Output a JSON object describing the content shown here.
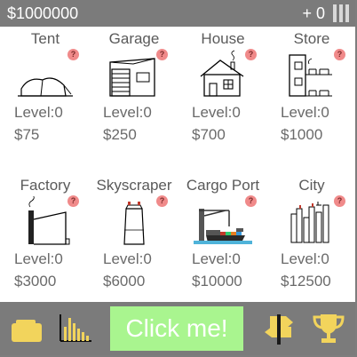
{
  "header": {
    "money": "$1000000",
    "income": "+ 0",
    "menu_icon": "hamburger-icon"
  },
  "buildings": [
    {
      "name": "Tent",
      "level_label": "Level:",
      "level": "0",
      "price": "$75",
      "icon": "tent-icon"
    },
    {
      "name": "Garage",
      "level_label": "Level:",
      "level": "0",
      "price": "$250",
      "icon": "garage-icon"
    },
    {
      "name": "House",
      "level_label": "Level:",
      "level": "0",
      "price": "$700",
      "icon": "house-icon"
    },
    {
      "name": "Store",
      "level_label": "Level:",
      "level": "0",
      "price": "$1000",
      "icon": "store-icon"
    },
    {
      "name": "Factory",
      "level_label": "Level:",
      "level": "0",
      "price": "$3000",
      "icon": "factory-icon"
    },
    {
      "name": "Skyscraper",
      "level_label": "Level:",
      "level": "0",
      "price": "$6000",
      "icon": "skyscraper-icon"
    },
    {
      "name": "Cargo Port",
      "level_label": "Level:",
      "level": "0",
      "price": "$10000",
      "icon": "cargo-port-icon"
    },
    {
      "name": "City",
      "level_label": "Level:",
      "level": "0",
      "price": "$12500",
      "icon": "city-icon"
    }
  ],
  "help_glyph": "?",
  "footer": {
    "click_label": "Click me!",
    "icons": [
      "wallet-icon",
      "stats-icon",
      "signpost-icon",
      "trophy-icon"
    ]
  },
  "colors": {
    "bar": "#7b7b7b",
    "click_button": "#a9f58f",
    "help_badge": "#f08a8a",
    "icon_yellow": "#f2d45c"
  }
}
